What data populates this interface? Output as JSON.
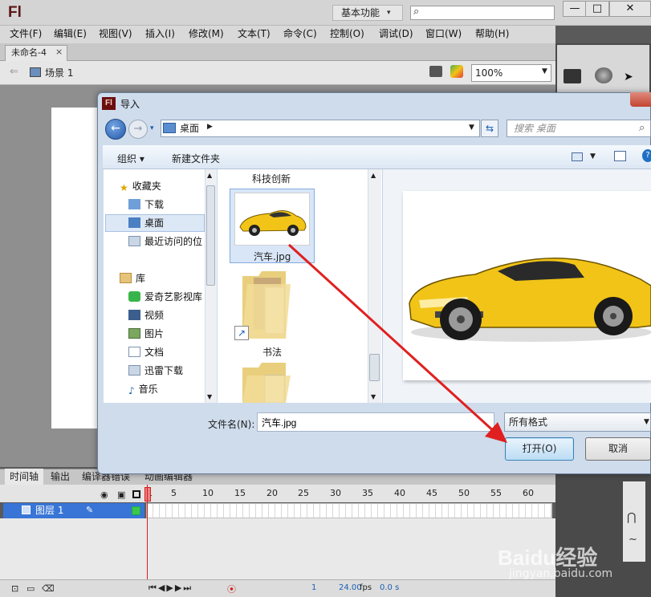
{
  "app": {
    "logo": "Fl",
    "workspace": "基本功能",
    "window_buttons": [
      "—",
      "□",
      "✕"
    ]
  },
  "menu": [
    "文件(F)",
    "编辑(E)",
    "视图(V)",
    "插入(I)",
    "修改(M)",
    "文本(T)",
    "命令(C)",
    "控制(O)",
    "调试(D)",
    "窗口(W)",
    "帮助(H)"
  ],
  "document": {
    "tab": "未命名-4",
    "close": "×",
    "scene": "场景 1",
    "zoom": "100%"
  },
  "timeline": {
    "tabs": [
      "时间轴",
      "输出",
      "编译器错误",
      "动画编辑器"
    ],
    "layer": "图层 1",
    "ticks": [
      "1",
      "5",
      "10",
      "15",
      "20",
      "25",
      "30",
      "35",
      "40",
      "45",
      "50",
      "55",
      "60"
    ],
    "fps": "24.00",
    "fps_unit": "fps",
    "time": "0.0 s",
    "frame": "1"
  },
  "dialog": {
    "title": "导入",
    "icon": "Fl",
    "address": "桌面",
    "search_placeholder": "搜索 桌面",
    "organize": "组织 ▾",
    "new_folder": "新建文件夹",
    "nav": {
      "favorites": "收藏夹",
      "downloads": "下载",
      "desktop": "桌面",
      "recent": "最近访问的位",
      "libraries": "库",
      "iqiyi": "爱奇艺影视库",
      "video": "视频",
      "pictures": "图片",
      "documents": "文档",
      "xunlei": "迅雷下载",
      "music": "音乐"
    },
    "files": {
      "group_title": "科技创新",
      "selected": "汽车.jpg",
      "folder": "书法"
    },
    "filename_label": "文件名(N):",
    "filename": "汽车.jpg",
    "filetype": "所有格式",
    "open": "打开(O)",
    "cancel": "取消"
  },
  "watermark": {
    "brand": "Baidu经验",
    "url": "jingyan.baidu.com"
  },
  "colors": {
    "selection": "#3875d7",
    "arrow": "#e02020",
    "car": "#f2c417"
  }
}
